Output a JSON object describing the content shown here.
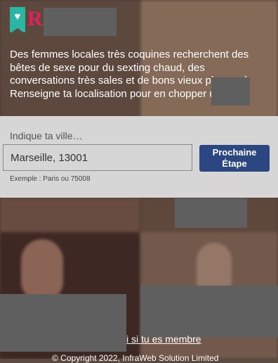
{
  "intro": {
    "text": "Des femmes locales très coquines recherchent des bêtes de sexe pour du sexting chaud, des conversations très sales et de bons vieux plans cul. Renseigne ta localisation pour en chopper une !"
  },
  "logo": {
    "letter": "R",
    "icon": "heart-icon"
  },
  "form": {
    "label": "Indique ta ville…",
    "city_value": "Marseille, 13001",
    "next_label": "Prochaine Étape",
    "hint": "Exemple : Paris ou 75008"
  },
  "footer": {
    "member_link": "i si tu es membre",
    "copyright": "© Copyright 2022, InfraWeb Solution Limited"
  },
  "colors": {
    "brand_teal": "#2bb5a3",
    "brand_pink": "#e0205e",
    "button_blue": "#2c4682",
    "panel_gray": "#d6d6d6"
  }
}
